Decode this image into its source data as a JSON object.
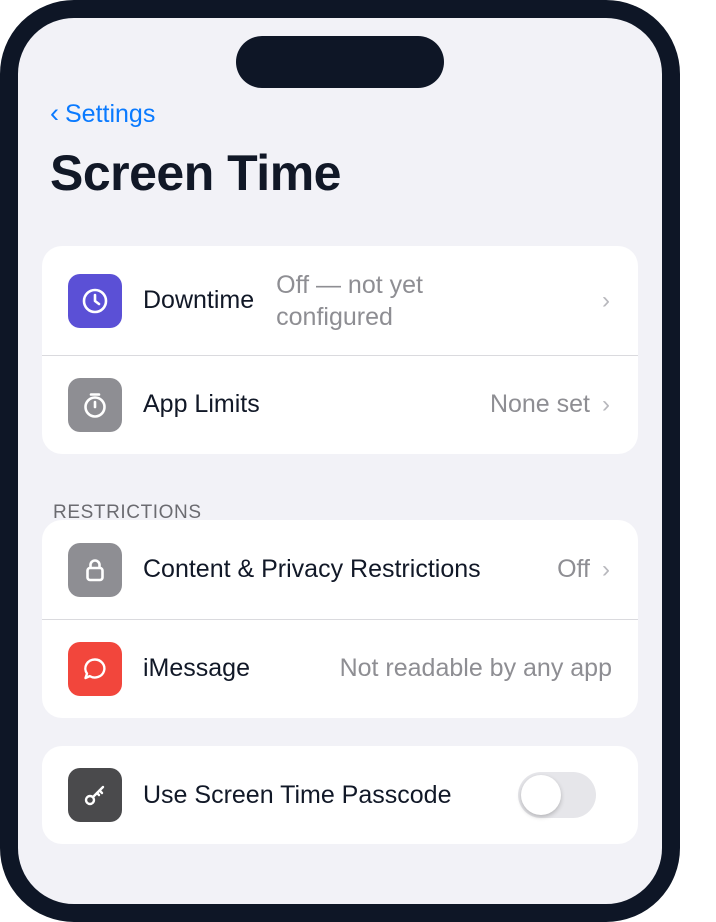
{
  "nav": {
    "back_label": "Settings"
  },
  "page": {
    "title": "Screen Time"
  },
  "colors": {
    "accent": "#0a7aff",
    "downtime_icon": "#5b50d6",
    "app_limits_icon": "#8e8e93",
    "content_privacy_icon": "#8e8e93",
    "imessage_icon": "#f2463c",
    "passcode_icon": "#4a4a4c",
    "frame": "#0e1626",
    "background": "#f2f2f7"
  },
  "group1": {
    "rows": [
      {
        "icon": "clock-icon",
        "label": "Downtime",
        "value": "Off — not yet configured"
      },
      {
        "icon": "timer-icon",
        "label": "App Limits",
        "value": "None set"
      }
    ]
  },
  "restrictions": {
    "header": "RESTRICTIONS",
    "rows": [
      {
        "icon": "lock-icon",
        "label": "Content & Privacy Restrictions",
        "value": "Off"
      },
      {
        "icon": "message-bubble-icon",
        "label": "iMessage",
        "value": "Not readable by any app"
      }
    ]
  },
  "passcode": {
    "icon": "key-icon",
    "label": "Use Screen Time Passcode",
    "enabled": false
  }
}
